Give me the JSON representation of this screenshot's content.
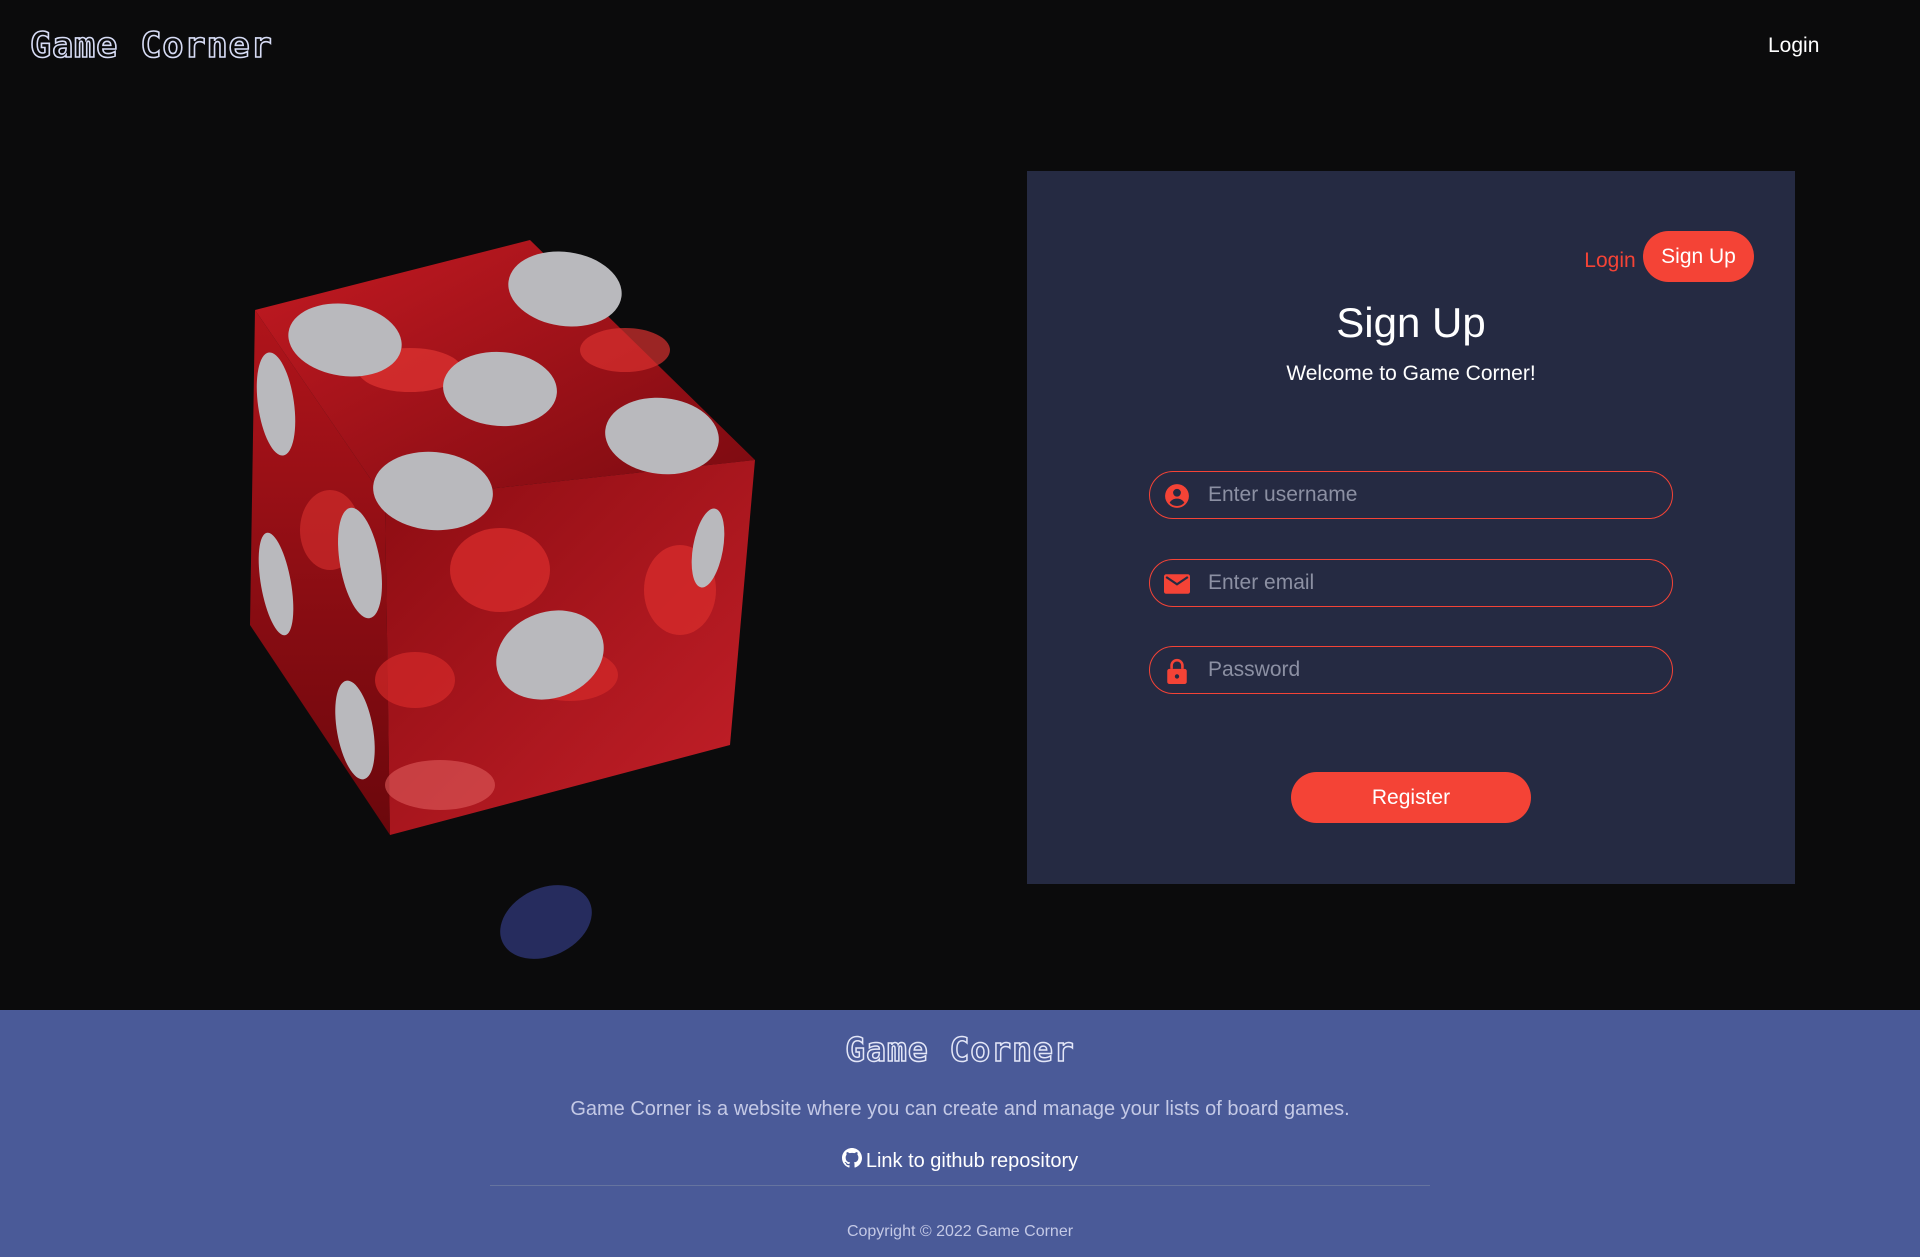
{
  "header": {
    "brand": "Game Corner",
    "login_link": "Login"
  },
  "hero": {
    "image_icon": "red-dice-image"
  },
  "card": {
    "tabs": {
      "login": "Login",
      "signup": "Sign Up"
    },
    "title": "Sign Up",
    "subtitle": "Welcome to Game Corner!",
    "fields": {
      "username": {
        "placeholder": "Enter username",
        "value": "",
        "icon": "user-circle-icon"
      },
      "email": {
        "placeholder": "Enter email",
        "value": "",
        "icon": "mail-icon"
      },
      "password": {
        "placeholder": "Password",
        "value": "",
        "icon": "lock-icon"
      }
    },
    "register_label": "Register"
  },
  "footer": {
    "brand": "Game Corner",
    "description": "Game Corner is a website where you can create and manage your lists of board games.",
    "github_link": "Link to github repository",
    "copyright": "Copyright © 2022 Game Corner"
  },
  "colors": {
    "accent": "#f44336",
    "card_bg": "#252a42",
    "footer_bg": "#4a5a98",
    "page_bg": "#0b0b0c"
  }
}
